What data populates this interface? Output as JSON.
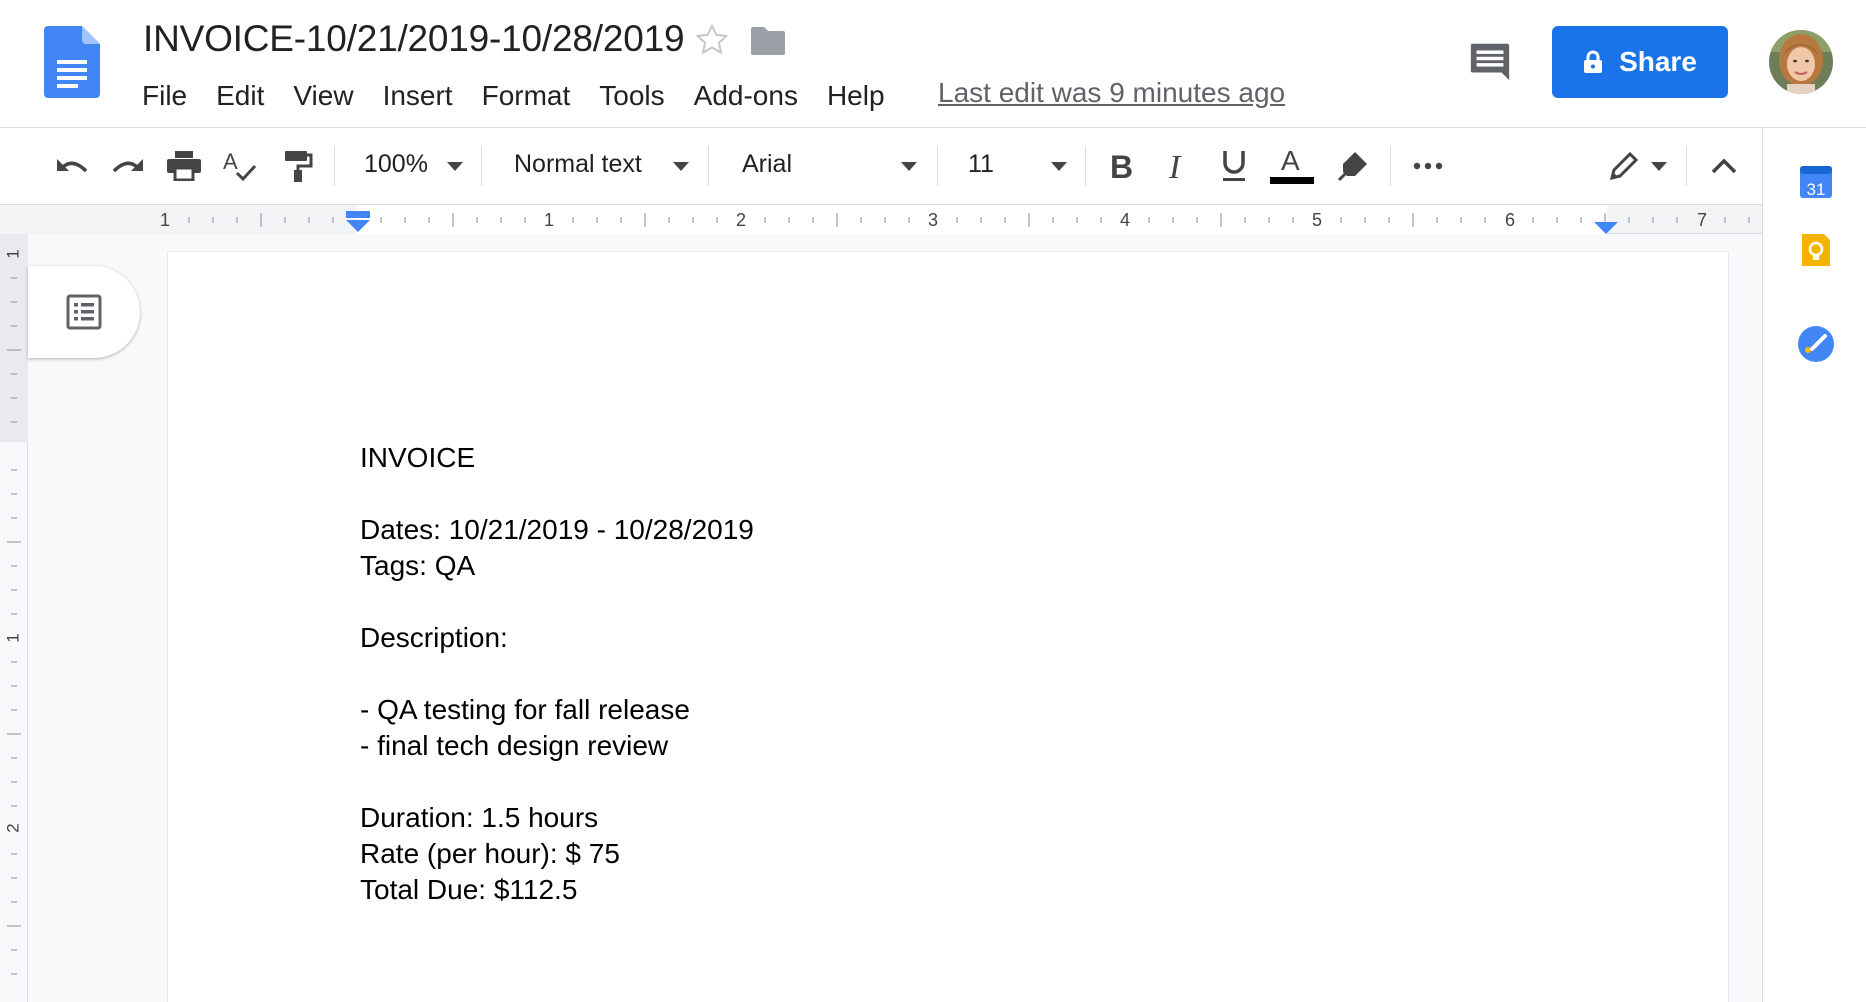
{
  "document": {
    "title": "INVOICE-10/21/2019-10/28/2019",
    "last_edit": "Last edit was 9 minutes ago"
  },
  "menu": [
    {
      "label": "File"
    },
    {
      "label": "Edit"
    },
    {
      "label": "View"
    },
    {
      "label": "Insert"
    },
    {
      "label": "Format"
    },
    {
      "label": "Tools"
    },
    {
      "label": "Add-ons"
    },
    {
      "label": "Help"
    }
  ],
  "share": {
    "label": "Share"
  },
  "toolbar": {
    "zoom": "100%",
    "style": "Normal text",
    "font": "Arial",
    "font_size": "11"
  },
  "ruler": {
    "horizontal_labels": [
      "1",
      "1",
      "2",
      "3",
      "4",
      "5",
      "6",
      "7"
    ],
    "vertical_labels": [
      "1",
      "1",
      "2"
    ]
  },
  "body": {
    "lines": [
      "INVOICE",
      "",
      "Dates: 10/21/2019 - 10/28/2019",
      "Tags: QA",
      "",
      "Description:",
      "",
      "- QA testing for fall release",
      "- final tech design review",
      "",
      "Duration: 1.5 hours",
      "Rate (per hour): $ 75",
      "Total Due: $112.5"
    ]
  },
  "side_panel": {
    "calendar_day": "31"
  },
  "colors": {
    "accent": "#1a73e8",
    "docs_blue": "#4285f4",
    "keep_yellow": "#f4b400"
  }
}
